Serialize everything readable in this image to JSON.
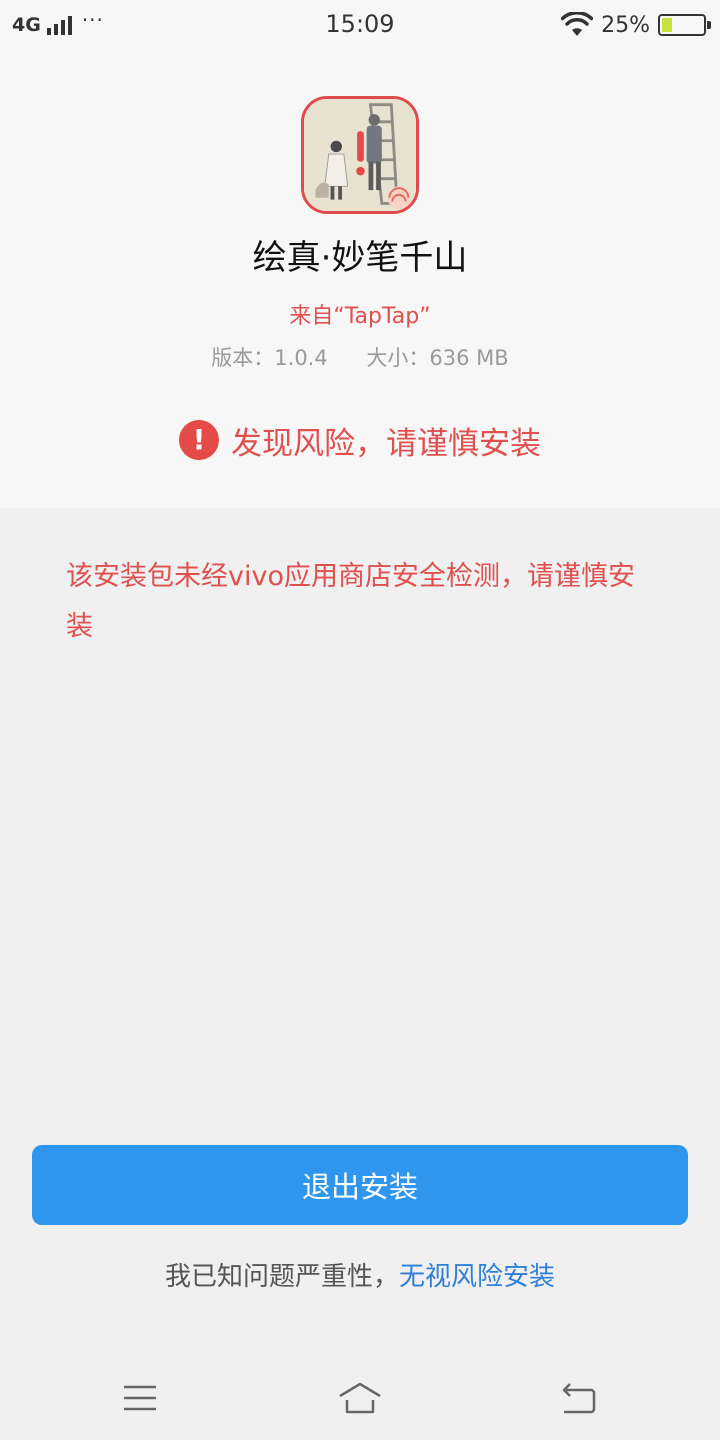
{
  "status_bar": {
    "network": "4G",
    "dots": "···",
    "time": "15:09",
    "battery_percent": "25%",
    "battery_level": 0.25,
    "icons": [
      "signal-icon",
      "wifi-icon",
      "battery-icon"
    ]
  },
  "app": {
    "name": "绘真·妙笔千山",
    "source": "来自“TapTap”",
    "version": "版本：1.0.4",
    "size": "大小：636 MB",
    "icon": "app-icon-with-warning-badge"
  },
  "risk": {
    "icon": "!",
    "title": "发现风险，请谨慎安装",
    "description": "该安装包未经vivo应用商店安全检测，请谨慎安装"
  },
  "actions": {
    "exit_label": "退出安装",
    "ignore_prefix": "我已知问题严重性，",
    "ignore_link": "无视风险安装"
  },
  "nav": {
    "icons": [
      "menu-icon",
      "home-icon",
      "back-icon"
    ]
  },
  "colors": {
    "danger": "#e0504f",
    "primary": "#2f96f0",
    "link": "#2f7fd8"
  }
}
